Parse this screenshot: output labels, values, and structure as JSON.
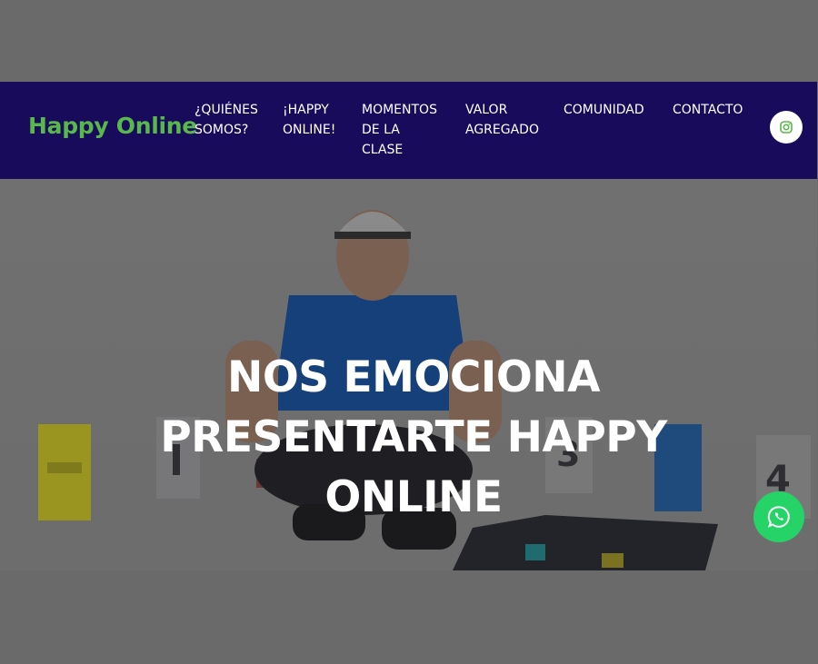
{
  "header": {
    "brand": "Happy Online",
    "nav": [
      {
        "label": "¿QUIÉNES\nSOMOS?"
      },
      {
        "label": "¡HAPPY\nONLINE!"
      },
      {
        "label": "MOMENTOS\nDE LA\nCLASE"
      },
      {
        "label": "VALOR\nAGREGADO"
      },
      {
        "label": "COMUNIDAD"
      },
      {
        "label": "CONTACTO"
      }
    ],
    "social_icon": "instagram-icon"
  },
  "hero": {
    "title": "NOS EMOCIONA\nPRESENTARTE HAPPY\nONLINE"
  },
  "floating": {
    "whatsapp_icon": "whatsapp-icon"
  },
  "colors": {
    "navbar_bg": "#180b5c",
    "brand": "#59b84a",
    "whatsapp": "#25d366",
    "overlay": "#6a6a6a"
  }
}
